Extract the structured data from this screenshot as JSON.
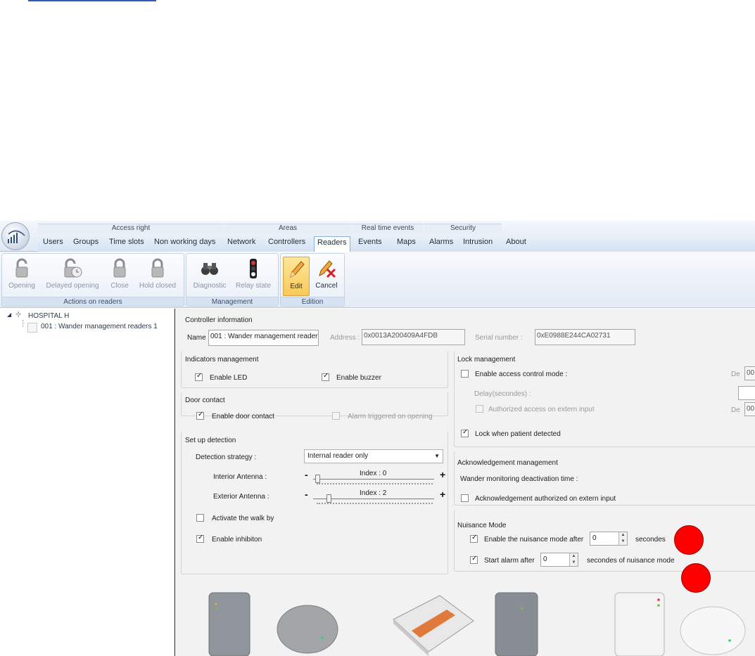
{
  "menu": {
    "groups": [
      "Access right",
      "Areas",
      "Real time events",
      "Security"
    ],
    "tabs": [
      "Users",
      "Groups",
      "Time slots",
      "Non working days",
      "Network",
      "Controllers",
      "Readers",
      "Events",
      "Maps",
      "Alarms",
      "Intrusion",
      "About"
    ],
    "active_tab": "Readers"
  },
  "ribbon": {
    "actions_on_readers": {
      "title": "Actions on readers",
      "buttons": [
        "Opening",
        "Delayed opening",
        "Close",
        "Hold closed"
      ]
    },
    "management": {
      "title": "Management",
      "buttons": [
        "Diagnostic",
        "Relay state"
      ]
    },
    "edition": {
      "title": "Edition",
      "buttons": [
        "Edit",
        "Cancel"
      ]
    }
  },
  "tree": {
    "root": "HOSPITAL H",
    "child": "001 : Wander management readers 1"
  },
  "controller_info": {
    "title": "Controller information",
    "name_label": "Name :",
    "name_value": "001 : Wander management reader",
    "address_label": "Address :",
    "address_value": "0x0013A200409A4FDB",
    "serial_label": "Serial number :",
    "serial_value": "0xE0988E244CA02731"
  },
  "indicators": {
    "title": "Indicators management",
    "enable_led": "Enable LED",
    "enable_buzzer": "Enable buzzer"
  },
  "door_contact": {
    "title": "Door contact",
    "enable_door_contact": "Enable door contact",
    "alarm_on_opening": "Alarm triggered on opening"
  },
  "setup_detection": {
    "title": "Set up detection",
    "strategy_label": "Detection strategy :",
    "strategy_value": "Internal reader only",
    "interior_label": "Interior Antenna :",
    "interior_index": "Index : 0",
    "exterior_label": "Exterior Antenna :",
    "exterior_index": "Index : 2",
    "walk_by": "Activate the walk by",
    "inhibition": "Enable inhibiton",
    "minus": "-",
    "plus": "+"
  },
  "lock": {
    "title": "Lock management",
    "access_control_mode": "Enable access control mode :",
    "de_label": "De",
    "de_value": "00",
    "delay_label": "Delay(secondes) :",
    "authorized_extern": "Authorized access on extern input",
    "lock_patient": "Lock when patient detected"
  },
  "ack": {
    "title": "Acknowledgement management",
    "deactivation_time": "Wander monitoring deactivation time :",
    "authorized_extern": "Acknowledgement authorized on extern input"
  },
  "nuisance": {
    "title": "Nuisance Mode",
    "enable_after": "Enable the nuisance mode after",
    "enable_value": "0",
    "enable_unit": "secondes",
    "start_alarm": "Start alarm after",
    "start_value": "0",
    "start_unit": "secondes of nuisance mode"
  },
  "colors": {
    "accent": "#2b5fb5",
    "marker": "#ff0000",
    "pressed": "#f9c95a"
  }
}
